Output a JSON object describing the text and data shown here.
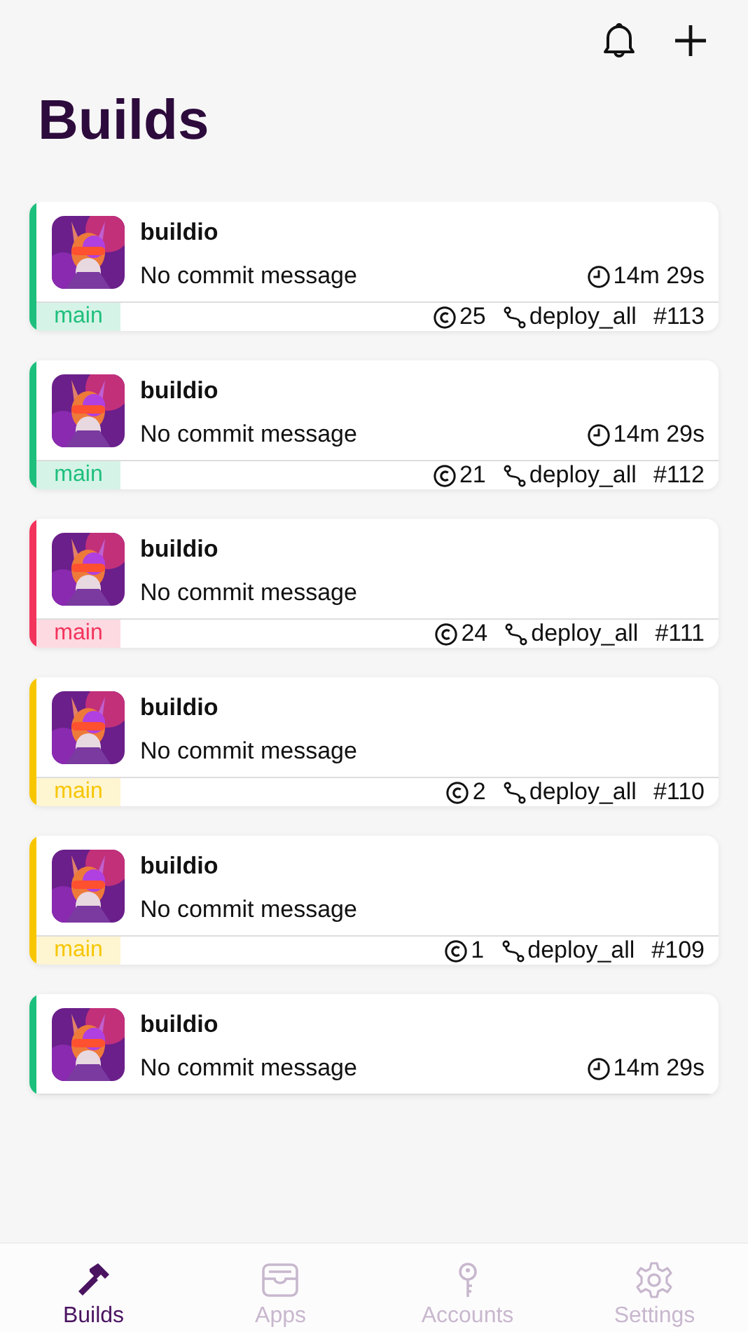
{
  "title": "Builds",
  "builds": [
    {
      "app": "buildio",
      "message": "No commit message",
      "duration": "14m 29s",
      "color": "#1dbf7c",
      "branch": "main",
      "credits": "25",
      "workflow": "deploy_all",
      "number": "#113"
    },
    {
      "app": "buildio",
      "message": "No commit message",
      "duration": "14m 29s",
      "color": "#1dbf7c",
      "branch": "main",
      "credits": "21",
      "workflow": "deploy_all",
      "number": "#112"
    },
    {
      "app": "buildio",
      "message": "No commit message",
      "color": "#f2335c",
      "branch": "main",
      "credits": "24",
      "workflow": "deploy_all",
      "number": "#111"
    },
    {
      "app": "buildio",
      "message": "No commit message",
      "color": "#f7c600",
      "branch": "main",
      "credits": "2",
      "workflow": "deploy_all",
      "number": "#110"
    },
    {
      "app": "buildio",
      "message": "No commit message",
      "color": "#f7c600",
      "branch": "main",
      "credits": "1",
      "workflow": "deploy_all",
      "number": "#109"
    },
    {
      "app": "buildio",
      "message": "No commit message",
      "duration": "14m 29s",
      "color": "#1dbf7c"
    }
  ],
  "tabs": [
    {
      "label": "Builds",
      "kind": "hammer",
      "selected": true
    },
    {
      "label": "Apps",
      "kind": "tray",
      "selected": false
    },
    {
      "label": "Accounts",
      "kind": "key",
      "selected": false
    },
    {
      "label": "Settings",
      "kind": "gear",
      "selected": false
    }
  ]
}
